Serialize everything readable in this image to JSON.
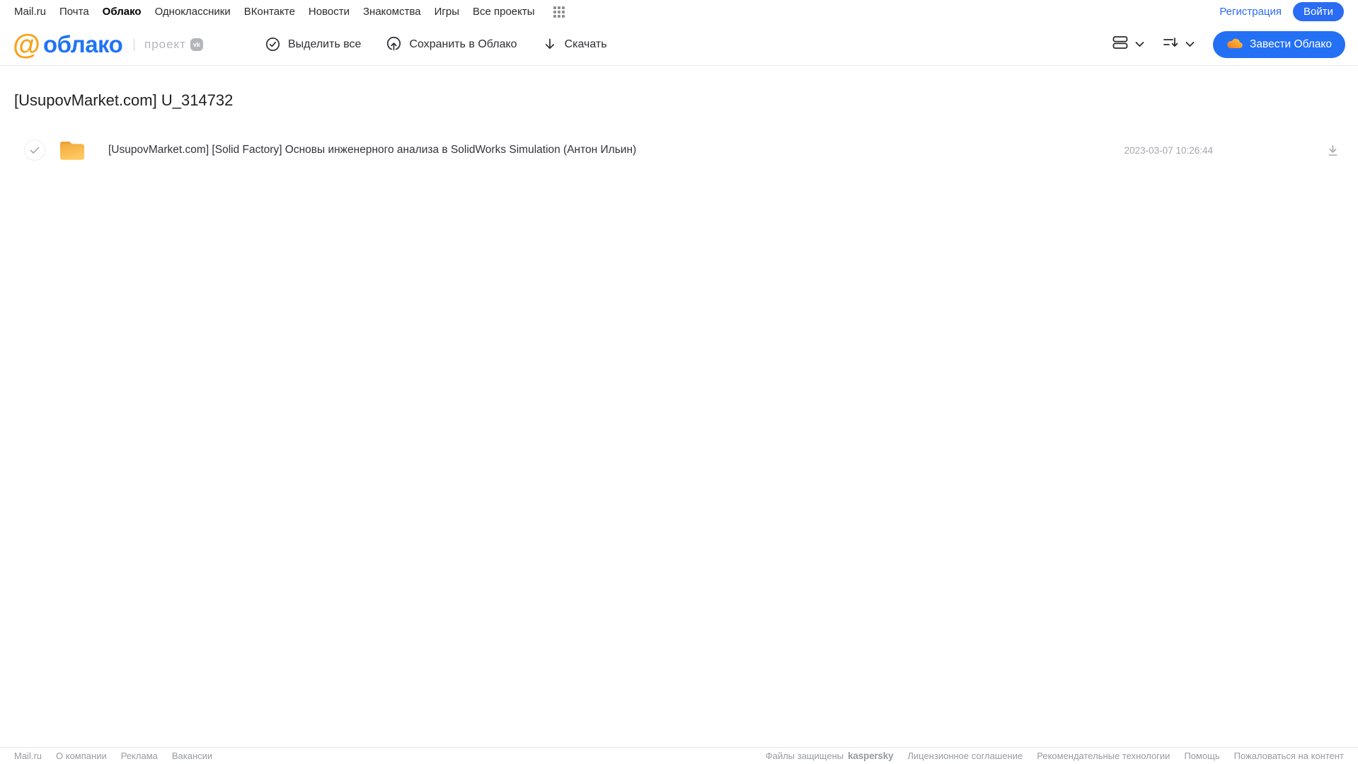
{
  "top_nav": {
    "links": [
      "Mail.ru",
      "Почта",
      "Облако",
      "Одноклассники",
      "ВКонтакте",
      "Новости",
      "Знакомства",
      "Игры",
      "Все проекты"
    ],
    "active_link": "Облако",
    "registration_label": "Регистрация",
    "login_label": "Войти"
  },
  "header": {
    "logo_at": "@",
    "logo_text": "облако",
    "project_label": "проект",
    "vk_badge": "vk",
    "actions": {
      "select_all": "Выделить все",
      "save_to_cloud": "Сохранить в Облако",
      "download": "Скачать"
    },
    "get_cloud_label": "Завести Облако"
  },
  "main": {
    "title": "[UsupovMarket.com] U_314732",
    "files": [
      {
        "type": "folder",
        "name": "[UsupovMarket.com] [Solid Factory] Основы инженерного анализа в SolidWorks Simulation (Антон Ильин)",
        "modified": "2023-03-07 10:26:44"
      }
    ]
  },
  "footer": {
    "left_links": [
      "Mail.ru",
      "О компании",
      "Реклама",
      "Вакансии"
    ],
    "protected_label": "Файлы защищены",
    "kaspersky_label": "kaspersky",
    "right_links": [
      "Лицензионное соглашение",
      "Рекомендательные технологии",
      "Помощь",
      "Пожаловаться на контент"
    ]
  },
  "colors": {
    "accent_blue": "#2a6cf4",
    "logo_orange": "#f9a21b",
    "logo_blue": "#2173f5",
    "folder_orange_top": "#f4a93e",
    "folder_orange_bottom": "#fdca60",
    "kaspersky_green": "#23a05c",
    "muted_gray": "#a5a7ad"
  }
}
